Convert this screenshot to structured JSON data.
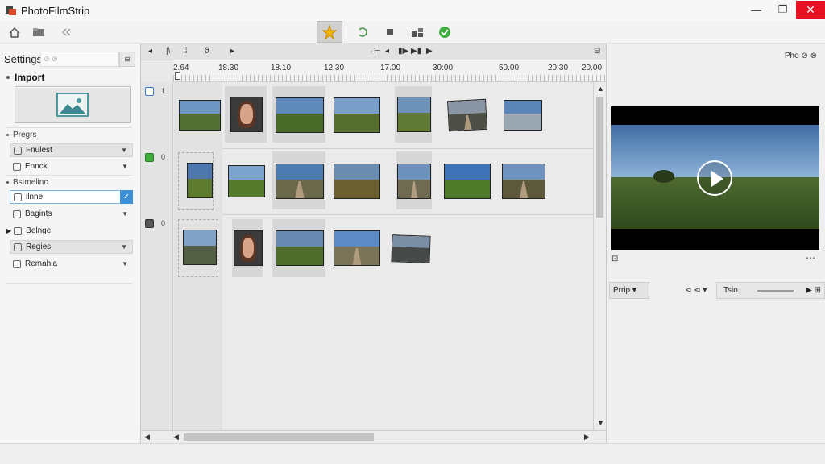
{
  "window": {
    "title": "PhotoFilmStrip",
    "minimize": "—",
    "maximize": "❐",
    "close": "✕"
  },
  "toolbar": {
    "icons": [
      "home-up-icon",
      "folder-icon",
      "back-icon",
      "star-icon",
      "refresh-icon",
      "stop-icon",
      "film-icon",
      "render-icon"
    ]
  },
  "sidebar": {
    "settings_label": "Settings",
    "settings_field": "⊘ ⊘",
    "settings_dd": "⊟",
    "import_label": "Import",
    "group1": "Pregrs",
    "items1": [
      {
        "label": "Fnulest",
        "style": "box"
      },
      {
        "label": "Ennck",
        "style": "plain"
      }
    ],
    "group2": "Bstmelinc",
    "items2": [
      {
        "label": "ilnne",
        "style": "sel"
      },
      {
        "label": "Bagints",
        "style": "plain"
      },
      {
        "label": "Belnge",
        "style": "plain"
      },
      {
        "label": "Regies",
        "style": "box"
      },
      {
        "label": "Remahia",
        "style": "plain"
      }
    ]
  },
  "timeline": {
    "toolbar_left": [
      "◂",
      "|\\",
      "⁞⁞",
      "ϑ",
      "▸"
    ],
    "toolbar_right": [
      "→⊢",
      "◂",
      "▮▶",
      "▶▮",
      "▶"
    ],
    "ruler": [
      "2.64",
      "18.30",
      "18.10",
      "12.30",
      "17.00",
      "30:00",
      "50.00",
      "20.30",
      "20.00"
    ],
    "tracks": [
      "1",
      "0",
      "0"
    ],
    "menu": "⊟"
  },
  "preview": {
    "label": "Pho ⊘ ⊗",
    "small_icon": "⊡",
    "more": "⋯",
    "dropdown": "Prrip ▾",
    "vol_left": "⊲ ⊲ ▾",
    "vol_label": "Tsio",
    "vol_right": "▶ ⊞"
  },
  "colors": {
    "close_red": "#e81123",
    "accent_blue": "#3d8fd6",
    "active_tool": "#cfcfcf"
  }
}
